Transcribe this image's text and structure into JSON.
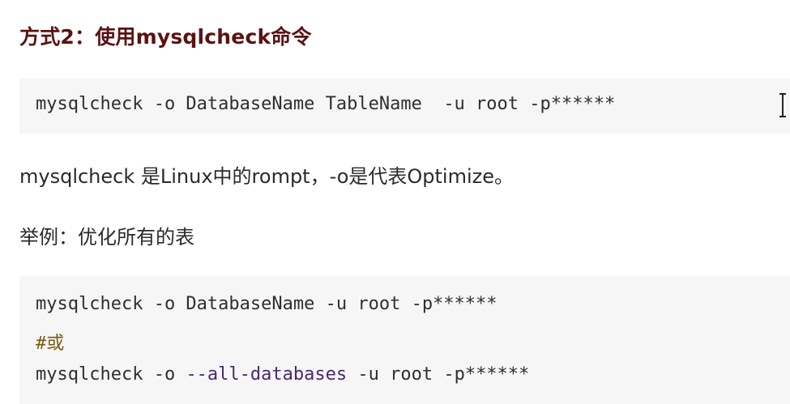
{
  "heading": "方式2：使用mysqlcheck命令",
  "code_block_1": {
    "line": "mysqlcheck -o DatabaseName TableName  -u root -p******"
  },
  "paragraph_1": "mysqlcheck 是Linux中的rompt，-o是代表Optimize。",
  "paragraph_2": "举例：优化所有的表",
  "code_block_2": {
    "line_1": "mysqlcheck -o DatabaseName -u root -p******",
    "comment": "#或",
    "line_3_prefix": "mysqlcheck -o ",
    "line_3_flag": "--all-databases",
    "line_3_suffix": " -u root -p******"
  },
  "colors": {
    "heading": "#5a1212",
    "code_background": "#f6f6f6",
    "comment": "#7a5c10",
    "flag": "#4a2a6e"
  },
  "icons": {
    "cursor": "text-cursor-icon"
  }
}
